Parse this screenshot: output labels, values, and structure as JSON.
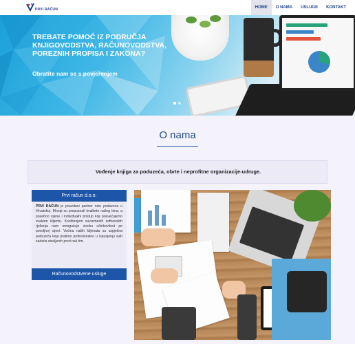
{
  "header": {
    "logo_text": "PRVI RAČUN",
    "nav": [
      {
        "label": "HOME",
        "active": true
      },
      {
        "label": "O NAMA",
        "active": false
      },
      {
        "label": "USLUGE",
        "active": false
      },
      {
        "label": "KONTAKT",
        "active": false
      }
    ]
  },
  "hero": {
    "title": "TREBATE POMOĆ IZ PODRUČJA KNJIGOVODSTVA, RAČUNOVODSTVA, POREZNIH PROPISA I ZAKONA?",
    "subtitle": "Obratite nam se s povjerenjem",
    "slides": 2,
    "active_slide": 1
  },
  "about": {
    "title": "O nama",
    "banner": "Vođenje knjiga za poduzeća, obrte i neprofitne organizacije-udruge.",
    "card": {
      "header": "Prvi račun d.o.o.",
      "company": "PRVI RAČUN",
      "body": " je pouzdani partner nizu poduzeća u Hrvatskoj. Mnogi su prepoznali kvalitete našeg tima, a posebno cijene i individualni pristup koji posvećujemo svakom klijentu. Korištenjem suvremenih softverskih rješenja nam omogućuje visoku učinkovitost po povoljnoj cijeni. Većina naših klijenata su uspješna poduzeća koja pratimo profesionalno u ispunjenju svih zadaća stavljenih pred naš tim.",
      "button": "Računovodstvene usluge"
    }
  },
  "colors": {
    "primary": "#1d56a8",
    "navy": "#1f3e8c",
    "page_bg": "#f4f2fb",
    "hero_blue": "#1aa0d8"
  }
}
